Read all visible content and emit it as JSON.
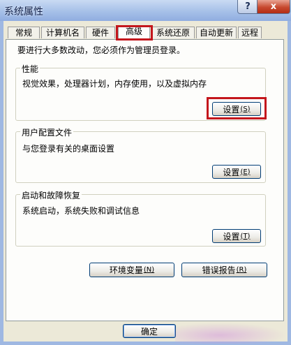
{
  "window": {
    "title": "系统属性",
    "help_label": "?",
    "close_label": "x"
  },
  "tabs": [
    {
      "label": "常规"
    },
    {
      "label": "计算机名"
    },
    {
      "label": "硬件"
    },
    {
      "label": "高级",
      "active": true
    },
    {
      "label": "系统还原"
    },
    {
      "label": "自动更新"
    },
    {
      "label": "远程"
    }
  ],
  "admin_note": "要进行大多数改动，您必须作为管理员登录。",
  "groups": {
    "performance": {
      "title": "性能",
      "description": "视觉效果，处理器计划，内存使用，以及虚拟内存",
      "button_label": "设置",
      "button_key": "(S)"
    },
    "user_profiles": {
      "title": "用户配置文件",
      "description": "与您登录有关的桌面设置",
      "button_label": "设置",
      "button_key": "(E)"
    },
    "startup_recovery": {
      "title": "启动和故障恢复",
      "description": "系统启动，系统失败和调试信息",
      "button_label": "设置",
      "button_key": "(T)"
    }
  },
  "env_vars": {
    "label": "环境变量",
    "key": "(N)"
  },
  "error_report": {
    "label": "错误报告",
    "key": "(R)"
  },
  "ok_label": "确定",
  "colors": {
    "highlight_red": "#c4161c",
    "dialog_face": "#ece9d8",
    "panel_bg": "#fdfdfb",
    "title_blue": "#a6c0e8"
  }
}
